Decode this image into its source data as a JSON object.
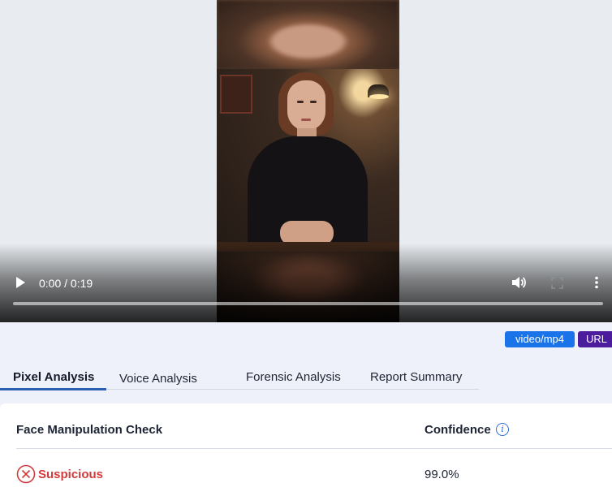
{
  "video": {
    "time_display": "0:00 / 0:19",
    "progress": 0.0
  },
  "badges": {
    "mime": "video/mp4",
    "source": "URL"
  },
  "tabs": [
    {
      "label": "Pixel Analysis",
      "active": true
    },
    {
      "label": "Voice Analysis",
      "active": false
    },
    {
      "label": "Forensic Analysis",
      "active": false
    },
    {
      "label": "Report Summary",
      "active": false
    }
  ],
  "result": {
    "check_header": "Face Manipulation Check",
    "confidence_header": "Confidence",
    "status": "Suspicious",
    "confidence_value": "99.0%",
    "status_color": "#d23b3b"
  },
  "colors": {
    "mime_badge": "#1a73e8",
    "source_badge": "#4b1c9b",
    "active_tab_underline": "#2b5fb0"
  },
  "icons": {
    "play": "play-icon",
    "volume": "volume-icon",
    "fullscreen": "fullscreen-icon",
    "more": "more-vertical-icon",
    "info": "info-icon",
    "status": "x-circle-icon"
  }
}
